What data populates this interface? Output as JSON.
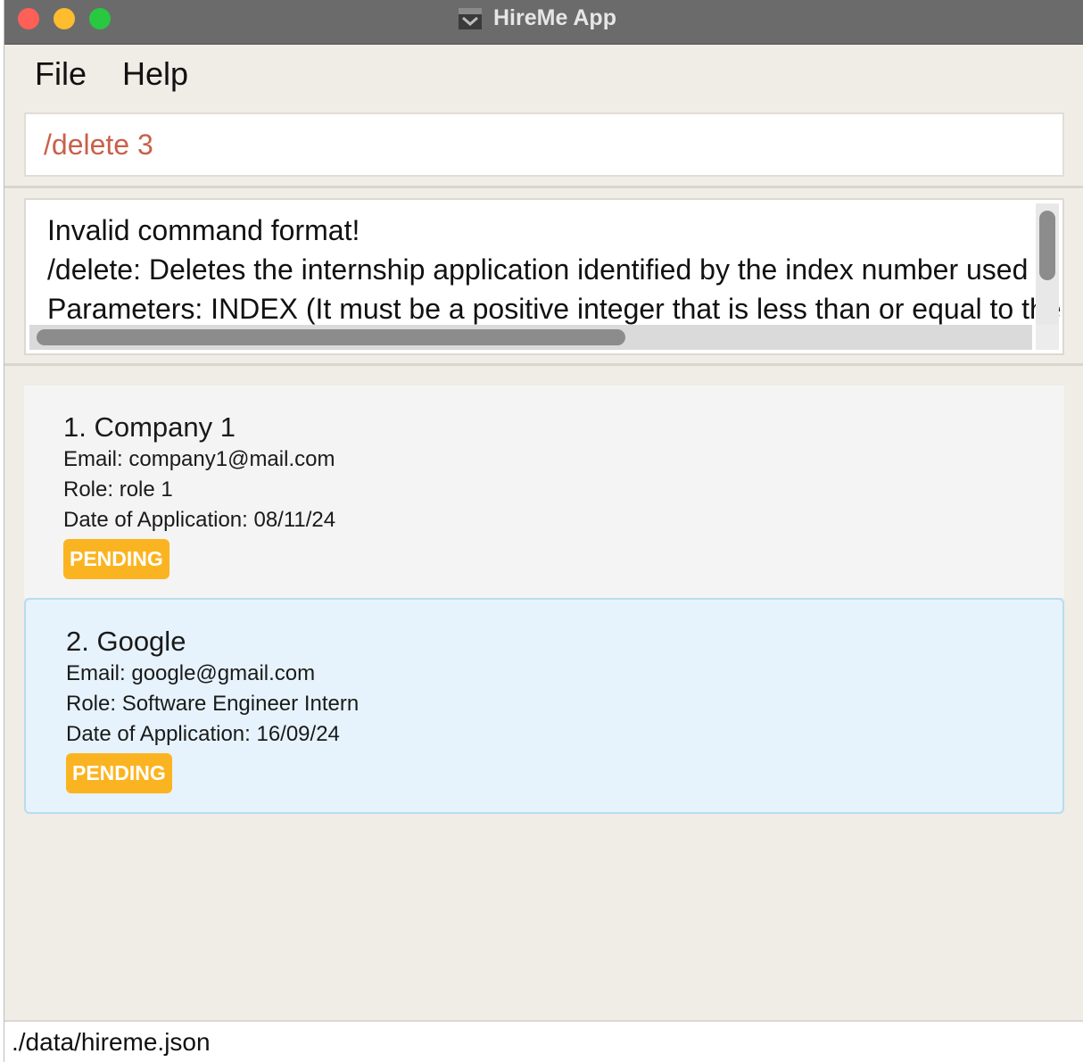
{
  "window": {
    "title": "HireMe App"
  },
  "menu": {
    "file": "File",
    "help": "Help"
  },
  "command": {
    "value": "/delete 3"
  },
  "result": {
    "lines": [
      "Invalid command format!",
      "/delete: Deletes the internship application identified by the index number used in the displayed list.",
      "Parameters: INDEX (It must be a positive integer that is less than or equal to the number of applications)"
    ]
  },
  "applications": [
    {
      "title": "1. Company 1",
      "email": "Email: company1@mail.com",
      "role": "Role: role 1",
      "date": "Date of Application: 08/11/24",
      "status": "PENDING"
    },
    {
      "title": "2. Google",
      "email": "Email: google@gmail.com",
      "role": "Role: Software Engineer Intern",
      "date": "Date of Application: 16/09/24",
      "status": "PENDING"
    }
  ],
  "status_bar": {
    "path": "./data/hireme.json"
  },
  "colors": {
    "command_text": "#c9604b",
    "badge": "#fbb421",
    "selected_card": "#e6f3fc",
    "titlebar": "#6b6b6b"
  }
}
